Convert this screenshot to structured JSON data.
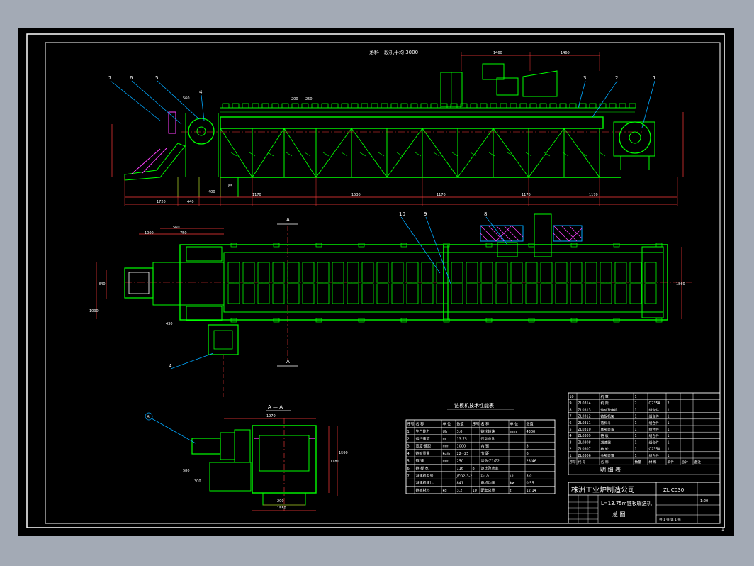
{
  "colors": {
    "frame": "#ffffff",
    "structure": "#00ff00",
    "dimension": "#ff3b3b",
    "leader": "#00a8ff",
    "text_white": "#ffffff",
    "text_yellow": "#ffff3a",
    "hatch": "#ff40ff",
    "cyan": "#00ffff",
    "background": "#000000",
    "paper": "#a3aab5"
  },
  "elevation_view": {
    "top_note": "落料一段机平均 3000",
    "dims_top": [
      "1460",
      "1460"
    ],
    "part_balloons": [
      "7",
      "6",
      "5",
      "4",
      "3",
      "2",
      "1"
    ],
    "dims_bottom_row1": [
      "1720",
      "440",
      "1170",
      "1530",
      "1170",
      "1170",
      "1170"
    ],
    "dims_mid": [
      "560",
      "200",
      "250",
      "85",
      "400"
    ]
  },
  "plan_view": {
    "section_mark_top": "A",
    "section_mark_bottom": "A",
    "part_balloons": [
      "10",
      "9",
      "8",
      "4"
    ],
    "dims_left": [
      "560",
      "750",
      "1000",
      "430",
      "840",
      "1090"
    ],
    "dim_right": "1860"
  },
  "section_view": {
    "title": "A — A",
    "part_balloon": "6",
    "dims": [
      "1970",
      "1180",
      "1590",
      "580",
      "300",
      "200",
      "1550"
    ]
  },
  "tech_table": {
    "title": "链板机技术性能表",
    "header": [
      "序号",
      "名  称",
      "单 位",
      "数值",
      "序号",
      "名  称",
      "单 位",
      "数值"
    ],
    "rows": [
      [
        "1",
        "生产能力",
        "t/h",
        "3.0",
        "",
        "链轮转速",
        "mm",
        "4300"
      ],
      [
        "2",
        "运行速度",
        "m",
        "13.75",
        "",
        "传动总比",
        "",
        ""
      ],
      [
        "3",
        "宽度·链距",
        "mm",
        "1000",
        "",
        "内  链",
        "",
        "3"
      ],
      [
        "4",
        "链板重量",
        "kg/m",
        "22~25",
        "",
        "节  距",
        "",
        "6"
      ],
      [
        "5",
        "链  速",
        "mm",
        "250",
        "",
        "齿数·Z1/Z2",
        "",
        "23/46"
      ],
      [
        "6",
        "链 板 宽",
        "",
        "116",
        "8",
        "速比及功率",
        "",
        ""
      ],
      [
        "7",
        "减速机型号",
        "",
        "JZQ2-3-2",
        "",
        "功  力",
        "t/h",
        "5.0"
      ],
      [
        "",
        "减速机速比",
        "",
        "841",
        "",
        "电机功率",
        "kw",
        "0.55"
      ],
      [
        "",
        "链板材料",
        "kg",
        "3.2",
        "10",
        "配套总重",
        "t",
        "12.14"
      ]
    ]
  },
  "parts_list": {
    "rows": [
      [
        "10",
        "",
        "机  罩",
        "1",
        "",
        ""
      ],
      [
        "9",
        "ZL0314",
        "机  架",
        "2",
        "Q235A",
        "2"
      ],
      [
        "8",
        "ZL0313",
        "传动及电机",
        "1",
        "组合件",
        "1"
      ],
      [
        "7",
        "ZL0312",
        "链板机架",
        "1",
        "组合件",
        "1"
      ],
      [
        "6",
        "ZL0311",
        "落料斗",
        "1",
        "组合件",
        "1"
      ],
      [
        "5",
        "ZL0310",
        "尾部装置",
        "1",
        "组合件",
        "1"
      ],
      [
        "4",
        "ZL0309",
        "链  板",
        "1",
        "组合件",
        "1"
      ],
      [
        "3",
        "ZL0308",
        "减速器",
        "1",
        "组合件",
        "1"
      ],
      [
        "2",
        "ZL0307",
        "链  轮",
        "1",
        "Q235A",
        "1"
      ],
      [
        "1",
        "ZL0306",
        "头部装置",
        "1",
        "组合件",
        "1"
      ]
    ],
    "header": [
      "序号",
      "代  号",
      "名  称",
      "数量",
      "材  料",
      "单件",
      "总计",
      "备注"
    ],
    "footer_title": "明      细      表"
  },
  "title_block": {
    "company": "株洲工业炉制造公司",
    "drawing_no": "ZL C030",
    "product": "L=13.75m链板输送机",
    "view_name": "总    图",
    "scale": "1:20",
    "sheet_text": "共 1 张  第 1 张"
  },
  "page_number": "1"
}
